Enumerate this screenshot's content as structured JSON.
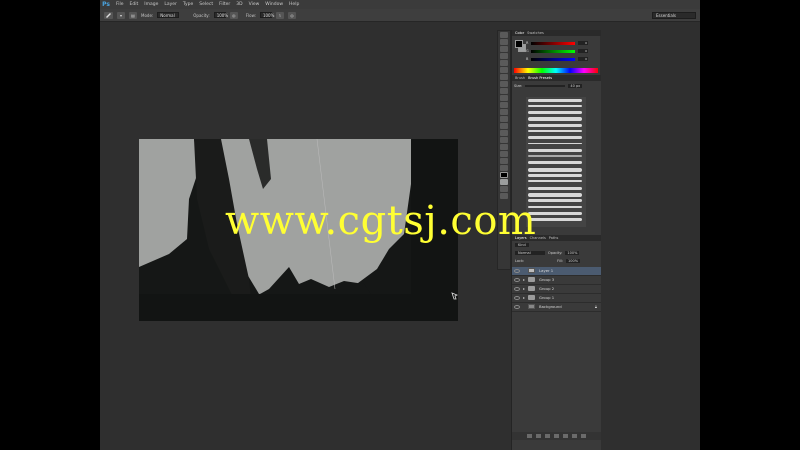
{
  "app": {
    "logo": "Ps"
  },
  "menubar": {
    "items": [
      "File",
      "Edit",
      "Image",
      "Layer",
      "Type",
      "Select",
      "Filter",
      "3D",
      "View",
      "Window",
      "Help"
    ]
  },
  "options_bar": {
    "mode_label": "Mode:",
    "mode_value": "Normal",
    "opacity_label": "Opacity:",
    "opacity_value": "100%",
    "flow_label": "Flow:",
    "flow_value": "100%",
    "workspace": "Essentials"
  },
  "color_panel": {
    "tabs": [
      "Color",
      "Swatches"
    ],
    "channels": [
      {
        "label": "R",
        "value": "0"
      },
      {
        "label": "G",
        "value": "0"
      },
      {
        "label": "B",
        "value": "0"
      }
    ],
    "foreground_color": "#000000",
    "background_color": "#9c9e9e"
  },
  "brush_panel": {
    "tabs": [
      "Brush",
      "Brush Presets"
    ],
    "size_label": "Size:",
    "size_value": "40 px"
  },
  "layers_panel": {
    "tabs": [
      "Layers",
      "Channels",
      "Paths"
    ],
    "kind_label": "Kind",
    "blend_mode": "Normal",
    "opacity_label": "Opacity:",
    "opacity_value": "100%",
    "lock_label": "Lock:",
    "fill_label": "Fill:",
    "fill_value": "100%",
    "layers": [
      {
        "name": "Layer 1",
        "type": "layer",
        "selected": true
      },
      {
        "name": "Group 3",
        "type": "group",
        "selected": false
      },
      {
        "name": "Group 2",
        "type": "group",
        "selected": false
      },
      {
        "name": "Group 1",
        "type": "group",
        "selected": false
      },
      {
        "name": "Background",
        "type": "layer",
        "selected": false
      }
    ]
  },
  "watermark": "www.cgtsj.com",
  "colors": {
    "app_bg": "#2f2f2f",
    "panel_bg": "#3a3a3a",
    "canvas_dark": "#151716",
    "canvas_light": "#a0a2a0",
    "selected_layer": "#4b5b70",
    "watermark": "#ffff33"
  }
}
